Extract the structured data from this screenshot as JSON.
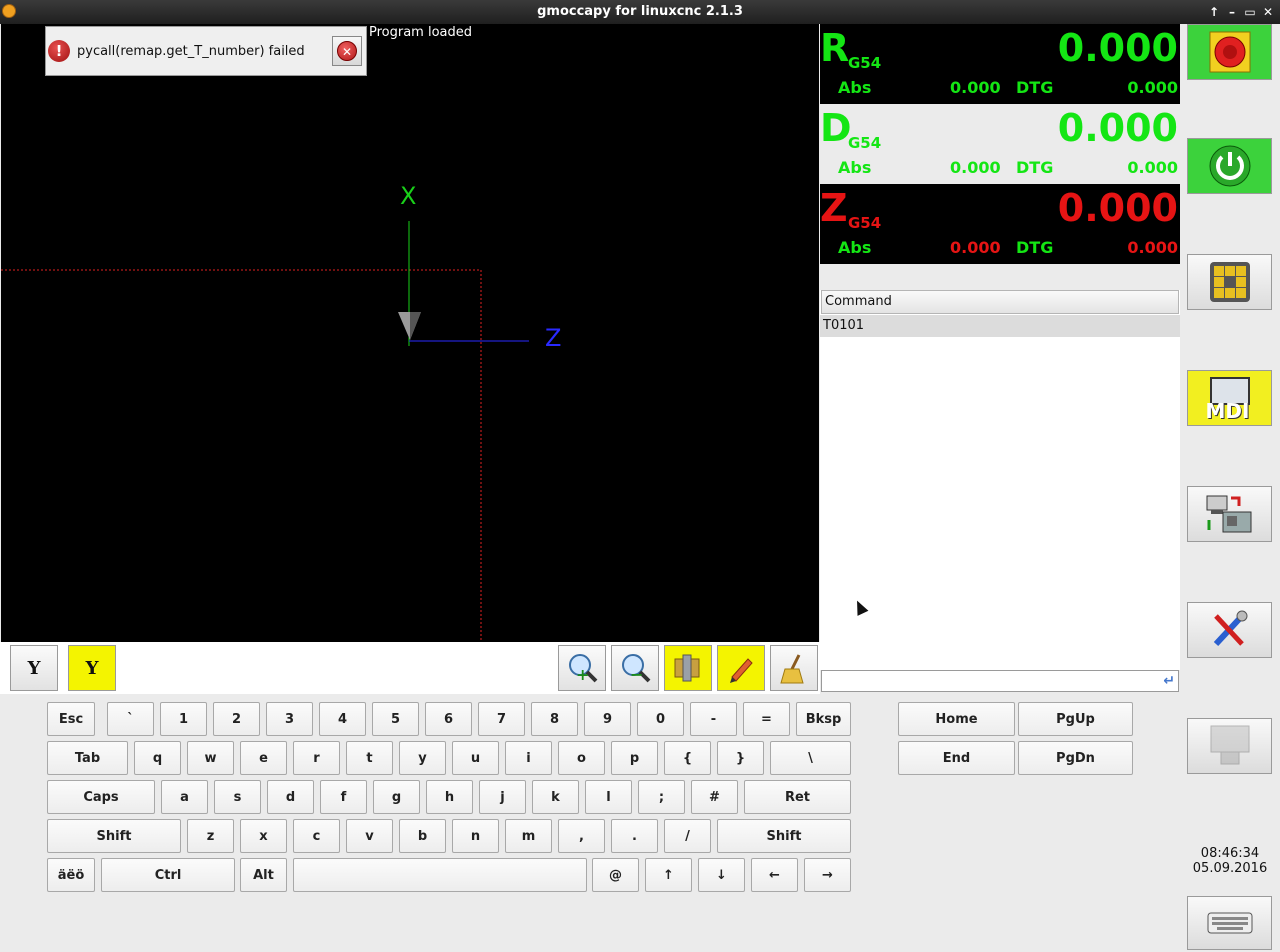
{
  "window": {
    "title": "gmoccapy for linuxcnc  2.1.3",
    "controls": [
      "↑",
      "–",
      "▭",
      "✕"
    ]
  },
  "preview": {
    "status": "Program loaded",
    "error_message": "pycall(remap.get_T_number) failed",
    "axis_x_label": "X",
    "axis_z_label": "Z"
  },
  "view_buttons": {
    "y_view": "Y",
    "y_view_active": "Y"
  },
  "dro": [
    {
      "axis": "R",
      "system": "G54",
      "value": "0.000",
      "abs_label": "Abs",
      "abs_value": "0.000",
      "dtg_label": "DTG",
      "dtg_value": "0.000",
      "color": "#14e614",
      "bg": "dark"
    },
    {
      "axis": "D",
      "system": "G54",
      "value": "0.000",
      "abs_label": "Abs",
      "abs_value": "0.000",
      "dtg_label": "DTG",
      "dtg_value": "0.000",
      "color": "#14e614",
      "bg": "light"
    },
    {
      "axis": "Z",
      "system": "G54",
      "value": "0.000",
      "abs_label": "Abs",
      "abs_value": "0.000",
      "dtg_label": "DTG",
      "dtg_value": "0.000",
      "color": "#e61414",
      "bg": "dark"
    }
  ],
  "command_list": {
    "header": "Command",
    "rows": [
      "T0101"
    ]
  },
  "mdi_input": {
    "value": ""
  },
  "sidebar": {
    "mdi_label": "MDI"
  },
  "clock": {
    "time": "08:46:34",
    "date": "05.09.2016"
  },
  "keyboard": {
    "row1": [
      "Esc",
      "`",
      "1",
      "2",
      "3",
      "4",
      "5",
      "6",
      "7",
      "8",
      "9",
      "0",
      "-",
      "=",
      "Bksp"
    ],
    "row2": [
      "Tab",
      "q",
      "w",
      "e",
      "r",
      "t",
      "y",
      "u",
      "i",
      "o",
      "p",
      "{",
      "}",
      "\\"
    ],
    "row3": [
      "Caps",
      "a",
      "s",
      "d",
      "f",
      "g",
      "h",
      "j",
      "k",
      "l",
      ";",
      "#",
      "Ret"
    ],
    "row4": [
      "Shift",
      "z",
      "x",
      "c",
      "v",
      "b",
      "n",
      "m",
      ",",
      ".",
      "/",
      "Shift"
    ],
    "row5": [
      "äëö",
      "Ctrl",
      "Alt",
      "",
      "@",
      "↑",
      "↓",
      "←",
      "→"
    ],
    "nav": [
      "Home",
      "PgUp",
      "End",
      "PgDn"
    ]
  }
}
